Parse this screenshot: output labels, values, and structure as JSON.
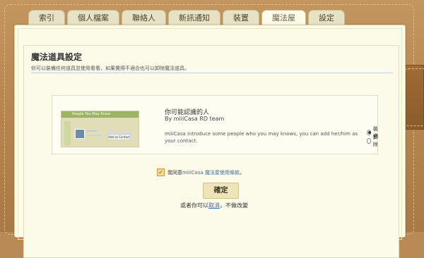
{
  "tabs": [
    {
      "label": "索引",
      "active": false
    },
    {
      "label": "個人檔案",
      "active": false
    },
    {
      "label": "聯絡人",
      "active": false
    },
    {
      "label": "新訊通知",
      "active": false
    },
    {
      "label": "裝置",
      "active": false
    },
    {
      "label": "魔法屋",
      "active": true
    },
    {
      "label": "設定",
      "active": false
    }
  ],
  "page": {
    "title": "魔法道具設定",
    "description": "你可以裝備任何道具並使用看看，如果覺得不適合也可以卸除魔法道具。"
  },
  "item": {
    "thumb_header": "People You May Know",
    "thumb_button": "Add as Contact",
    "name": "你可能認識的人",
    "author": "By miiiCasa RD team",
    "intro": "miiiCasa introduce some people who you may knows, you can add her/him as your contact.",
    "options": [
      {
        "label": "裝備",
        "selected": true
      },
      {
        "label": "卸除",
        "selected": false
      }
    ]
  },
  "agreement": {
    "checked": true,
    "prefix": "我同意",
    "link": "miiiCasa 魔法屋使用條款",
    "suffix": "。"
  },
  "confirm_label": "確定",
  "cancel": {
    "prefix": "或者你可以",
    "link": "取消",
    "suffix": "，不做改變"
  },
  "colors": {
    "leather": "#b98a55",
    "paper": "#fcfbe6",
    "link": "#3d6f97",
    "divider": "#b6d2e8"
  }
}
